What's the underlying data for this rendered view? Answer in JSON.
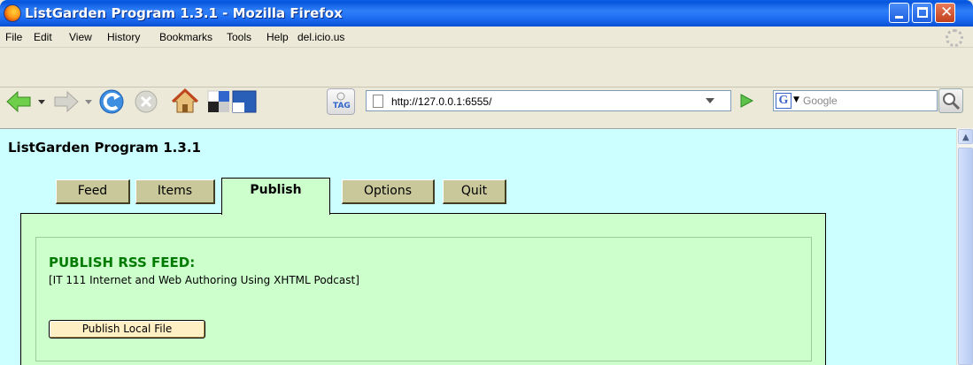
{
  "window": {
    "title": "ListGarden Program 1.3.1 - Mozilla Firefox"
  },
  "menubar": {
    "items": [
      "File",
      "Edit",
      "View",
      "History",
      "Bookmarks",
      "Tools",
      "Help",
      "del.icio.us"
    ]
  },
  "navbar": {
    "url": "http://127.0.0.1:6555/",
    "search_placeholder": "Google",
    "search_engine_letter": "G",
    "tag_label": "TAG"
  },
  "page": {
    "title": "ListGarden Program 1.3.1",
    "tabs": [
      {
        "label": "Feed",
        "active": false
      },
      {
        "label": "Items",
        "active": false
      },
      {
        "label": "Publish",
        "active": true
      },
      {
        "label": "Options",
        "active": false
      },
      {
        "label": "Quit",
        "active": false
      }
    ],
    "section_heading": "PUBLISH RSS FEED:",
    "feed_name": "[IT 111 Internet and Web Authoring Using XHTML Podcast]",
    "publish_button_label": "Publish Local File"
  },
  "colors": {
    "content_background": "#ccffff",
    "panel_background": "#ccffcc",
    "heading_green": "#007a00",
    "tab_inactive": "#c8c89a",
    "button_background": "#ffefc4"
  }
}
